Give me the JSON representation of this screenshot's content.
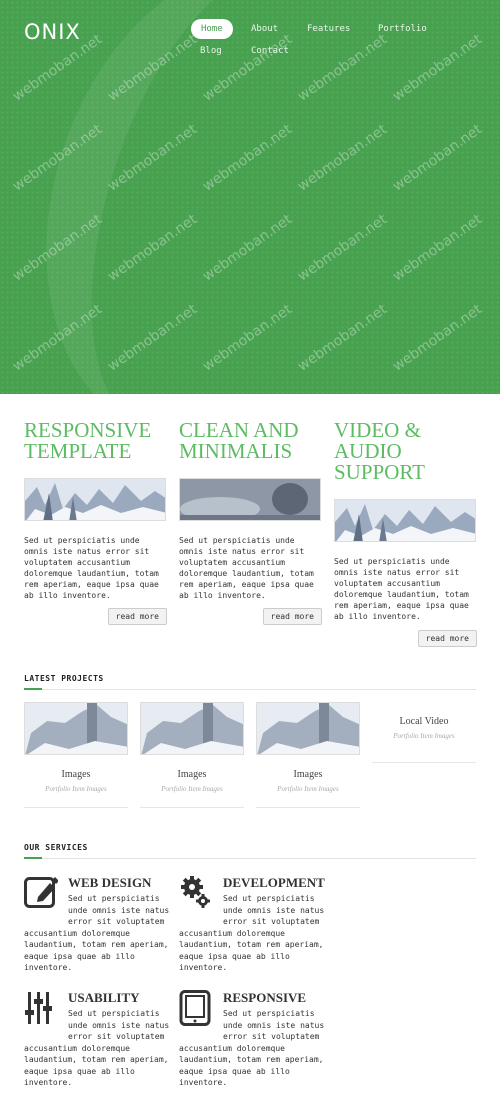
{
  "brand": {
    "logo": "ONIX",
    "accent": "#47a14f",
    "title_green": "#5dbb63"
  },
  "nav": {
    "items": [
      {
        "label": "Home",
        "active": true
      },
      {
        "label": "About"
      },
      {
        "label": "Features"
      },
      {
        "label": "Portfolio"
      },
      {
        "label": "Blog"
      },
      {
        "label": "Contact"
      }
    ]
  },
  "watermark": "webmoban.net",
  "features": [
    {
      "title": "RESPONSIVE\nTEMPLATE",
      "text": "Sed ut perspiciatis unde omnis iste natus error sit voluptatem accusantium doloremque laudantium, totam rem aperiam, eaque ipsa quae ab illo inventore.",
      "button": "read more"
    },
    {
      "title": "CLEAN AND\nMINIMALIS",
      "text": "Sed ut perspiciatis unde omnis iste natus error sit voluptatem accusantium doloremque laudantium, totam rem aperiam, eaque ipsa quae ab illo inventore.",
      "button": "read more"
    },
    {
      "title": "VIDEO &\nAUDIO\nSUPPORT",
      "text": "Sed ut perspiciatis unde omnis iste natus error sit voluptatem accusantium doloremque laudantium, totam rem aperiam, eaque ipsa quae ab illo inventore.",
      "button": "read more"
    }
  ],
  "projects": {
    "heading": "LATEST PROJECTS",
    "items": [
      {
        "title": "Images",
        "subtitle": "Portfolio Item Images"
      },
      {
        "title": "Images",
        "subtitle": "Portfolio Item Images"
      },
      {
        "title": "Images",
        "subtitle": "Portfolio Item Images"
      },
      {
        "title": "Local Video",
        "subtitle": "Portfolio Item Images"
      }
    ]
  },
  "services": {
    "heading": "OUR SERVICES",
    "items": [
      {
        "title": "WEB DESIGN",
        "icon": "edit-icon",
        "text_indented": "Sed ut perspiciatis unde omnis iste natus error sit voluptatem",
        "text": "accusantium doloremque laudantium, totam rem aperiam, eaque ipsa quae ab illo inventore."
      },
      {
        "title": "DEVELOPMENT",
        "icon": "gears-icon",
        "text_indented": "Sed ut perspiciatis unde omnis iste natus error sit voluptatem",
        "text": "accusantium doloremque laudantium, totam rem aperiam, eaque ipsa quae ab illo inventore."
      },
      {
        "title": "USABILITY",
        "icon": "sliders-icon",
        "text_indented": "Sed ut perspiciatis unde omnis iste natus error sit voluptatem",
        "text": "accusantium doloremque laudantium, totam rem aperiam, eaque ipsa quae ab illo inventore."
      },
      {
        "title": "RESPONSIVE",
        "icon": "tablet-icon",
        "text_indented": "Sed ut perspiciatis unde omnis iste natus error sit voluptatem",
        "text": "accusantium doloremque laudantium, totam rem aperiam, eaque ipsa quae ab illo inventore."
      }
    ]
  }
}
